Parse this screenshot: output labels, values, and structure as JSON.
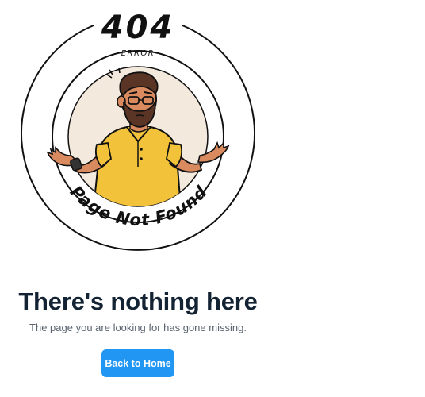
{
  "illustration": {
    "code_text": "404",
    "error_text": "ERROR",
    "caption_text": "Page Not Found",
    "colors": {
      "ink": "#111111",
      "background_disc": "#f4e9dd",
      "shirt": "#f3c23b",
      "skin": "#d98a5f",
      "hair": "#5a3424"
    }
  },
  "main": {
    "heading": "There's nothing here",
    "message": "The page you are looking for has gone missing."
  },
  "actions": {
    "home_label": "Back to Home"
  },
  "colors": {
    "heading": "#132333",
    "message": "#5a6470",
    "button": "#2196f3"
  }
}
